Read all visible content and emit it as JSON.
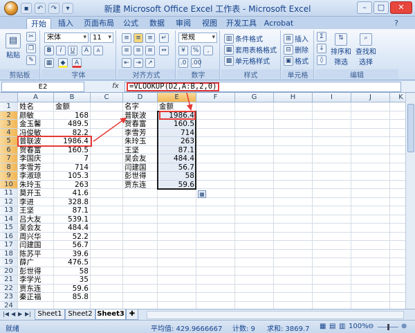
{
  "window": {
    "title": "新建 Microsoft Office Excel 工作表 - Microsoft Excel"
  },
  "tabs": [
    "开始",
    "插入",
    "页面布局",
    "公式",
    "数据",
    "审阅",
    "视图",
    "开发工具",
    "Acrobat"
  ],
  "ribbon": {
    "clipboard": {
      "paste": "粘贴",
      "label": "剪贴板"
    },
    "font": {
      "name": "宋体",
      "size": "11",
      "bold": "B",
      "italic": "I",
      "underline": "U",
      "grow": "A",
      "shrink": "A",
      "label": "字体"
    },
    "alignment": {
      "label": "对齐方式"
    },
    "number": {
      "format": "常规",
      "label": "数字",
      "percent": "%"
    },
    "styles": {
      "cond": "条件格式",
      "table": "套用表格格式",
      "cell": "单元格样式",
      "label": "样式"
    },
    "cells": {
      "insert": "插入",
      "delete": "删除",
      "format": "格式",
      "label": "单元格"
    },
    "editing": {
      "sort": "排序和",
      "sort2": "筛选",
      "find": "查找和",
      "find2": "选择",
      "label": "编辑"
    }
  },
  "formula_bar": {
    "name_box": "E2",
    "fx": "fx",
    "formula": "=VLOOKUP(D2,A:B,2,0)"
  },
  "columns": [
    "A",
    "B",
    "C",
    "D",
    "E",
    "F",
    "G",
    "H",
    "I",
    "J",
    "K"
  ],
  "rows": [
    "1",
    "2",
    "3",
    "4",
    "5",
    "6",
    "7",
    "8",
    "9",
    "10",
    "11",
    "12",
    "13",
    "14",
    "15",
    "16",
    "17",
    "18",
    "19",
    "20",
    "21",
    "22",
    "23",
    "24"
  ],
  "colA": [
    "姓名",
    "颜敏",
    "金玉馨",
    "冯俊敏",
    "普联波",
    "贺春富",
    "李国庆",
    "李雪芳",
    "李淑琼",
    "朱玲玉",
    "莫开玉",
    "李进",
    "王坚",
    "吕大友",
    "吴会友",
    "周兴华",
    "闫建国",
    "陈苏平",
    "薛广",
    "彭世得",
    "李学光",
    "贾东连",
    "秦正福"
  ],
  "colB": [
    "金额",
    "168",
    "489.5",
    "82.2",
    "1986.4",
    "160.5",
    "7",
    "714",
    "105.3",
    "263",
    "41.6",
    "328.8",
    "87.1",
    "539.1",
    "484.4",
    "52.2",
    "56.7",
    "39.6",
    "476.5",
    "58",
    "35",
    "59.6",
    "85.8"
  ],
  "colD": [
    "名字",
    "普联波",
    "贺春富",
    "李雪芳",
    "朱玲玉",
    "王坚",
    "吴会友",
    "闫建国",
    "彭世得",
    "贾东连"
  ],
  "colE": [
    "金额",
    "1986.4",
    "160.5",
    "714",
    "263",
    "87.1",
    "484.4",
    "56.7",
    "58",
    "59.6"
  ],
  "sheet_tabs": [
    "Sheet1",
    "Sheet2",
    "Sheet3"
  ],
  "status": {
    "ready": "就绪",
    "average": "平均值: 429.9666667",
    "count": "计数: 9",
    "sum": "求和: 3869.7",
    "zoom": "100%"
  }
}
